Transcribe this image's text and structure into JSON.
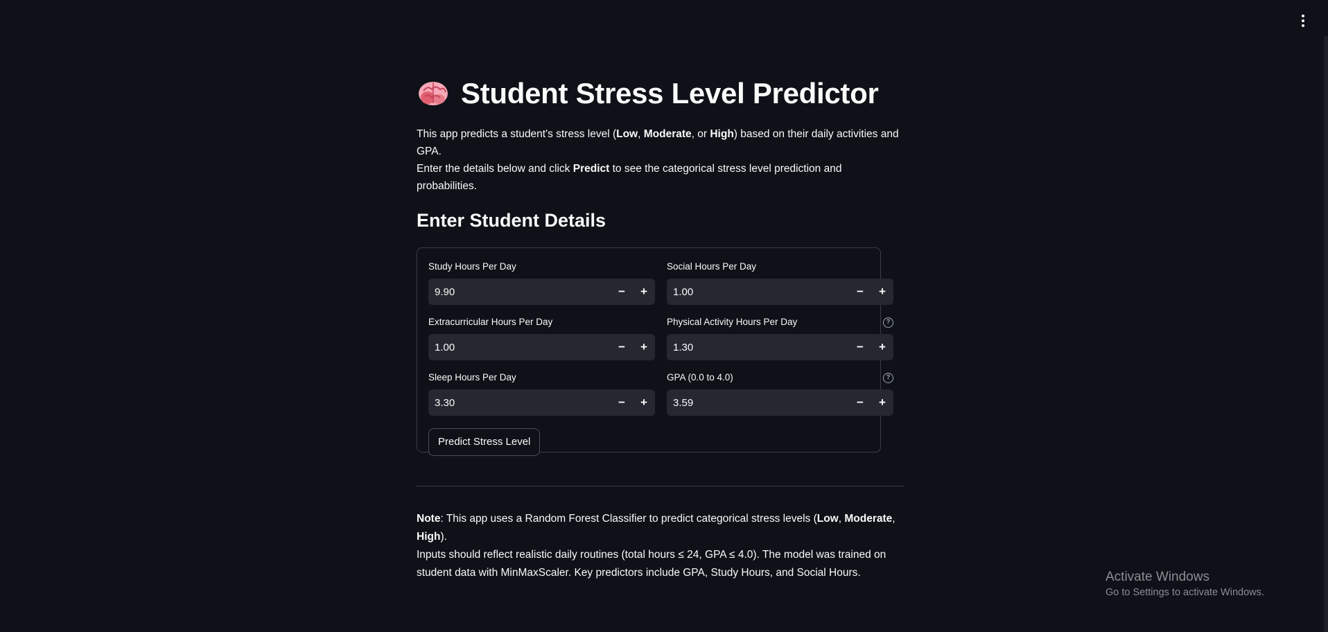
{
  "title": "Student Stress Level Predictor",
  "intro": {
    "l1_a": "This app predicts a student's stress level (",
    "l1_b1": "Low",
    "l1_c": ", ",
    "l1_b2": "Moderate",
    "l1_d": ", or ",
    "l1_b3": "High",
    "l1_e": ") based on their daily activities and GPA.",
    "l2_a": "Enter the details below and click ",
    "l2_b": "Predict",
    "l2_c": " to see the categorical stress level prediction and probabilities."
  },
  "section_title": "Enter Student Details",
  "fields": [
    {
      "label": "Study Hours Per Day",
      "value": "9.90",
      "help": false
    },
    {
      "label": "Social Hours Per Day",
      "value": "1.00",
      "help": false
    },
    {
      "label": "Extracurricular Hours Per Day",
      "value": "1.00",
      "help": false
    },
    {
      "label": "Physical Activity Hours Per Day",
      "value": "1.30",
      "help": true
    },
    {
      "label": "Sleep Hours Per Day",
      "value": "3.30",
      "help": false
    },
    {
      "label": "GPA (0.0 to 4.0)",
      "value": "3.59",
      "help": true
    }
  ],
  "stepper": {
    "minus": "−",
    "plus": "+"
  },
  "help_glyph": "?",
  "predict_label": "Predict Stress Level",
  "note": {
    "b1": "Note",
    "t1": ": This app uses a Random Forest Classifier to predict categorical stress levels (",
    "b2": "Low",
    "t2": ", ",
    "b3": "Moderate",
    "t3": ", ",
    "b4": "High",
    "t4": ").",
    "l2": "Inputs should reflect realistic daily routines (total hours ≤ 24, GPA ≤ 4.0). The model was trained on",
    "l3": "student data with MinMaxScaler. Key predictors include GPA, Study Hours, and Social Hours."
  },
  "watermark": {
    "line1": "Activate Windows",
    "line2": "Go to Settings to activate Windows."
  },
  "colors": {
    "background": "#0e1117",
    "input_bg": "#262730",
    "border": "#3b3e48"
  },
  "icons": {
    "title": "brain-icon",
    "menu": "kebab-menu-icon",
    "help": "help-circle-icon"
  }
}
